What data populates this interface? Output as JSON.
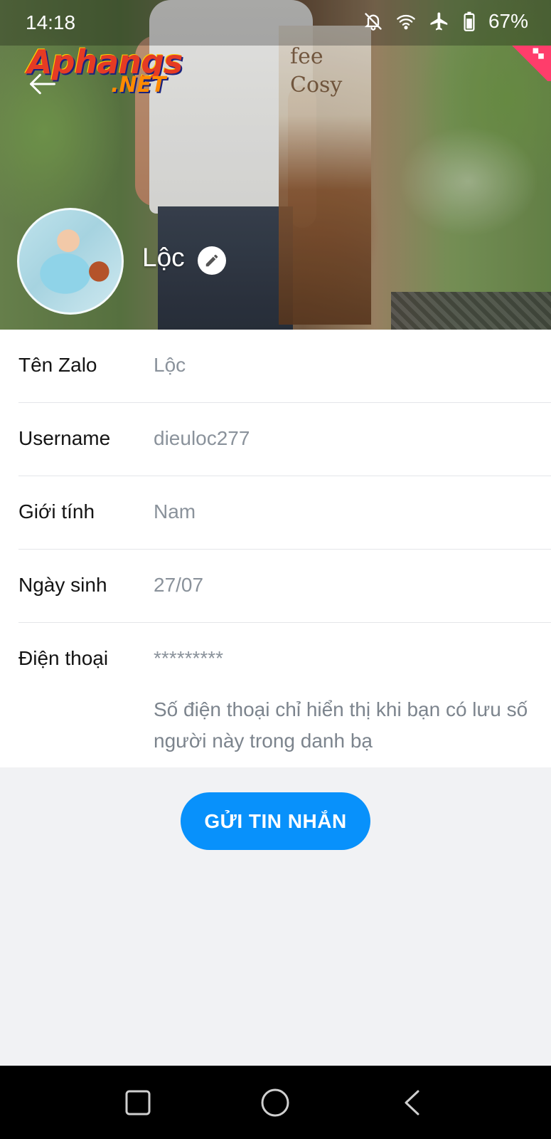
{
  "status_bar": {
    "time": "14:18",
    "battery": "67%",
    "icons": [
      "bell-off-icon",
      "wifi-icon",
      "airplane-icon",
      "battery-icon"
    ]
  },
  "watermark": {
    "main": "Aphangs",
    "sub": ".NET"
  },
  "cover": {
    "poster_text": "fee\nCosy"
  },
  "profile": {
    "name": "Lộc"
  },
  "info_rows": [
    {
      "label": "Tên Zalo",
      "value": "Lộc"
    },
    {
      "label": "Username",
      "value": "dieuloc277"
    },
    {
      "label": "Giới tính",
      "value": "Nam"
    },
    {
      "label": "Ngày sinh",
      "value": "27/07"
    },
    {
      "label": "Điện thoại",
      "value": "*********"
    }
  ],
  "phone_note": "Số điện thoại chỉ hiển thị khi bạn có lưu số người này trong danh bạ",
  "send_button": "GỬI TIN NHẮN",
  "colors": {
    "accent": "#0891fb",
    "label": "#141414",
    "value": "#8a929b",
    "background": "#f1f2f4"
  }
}
